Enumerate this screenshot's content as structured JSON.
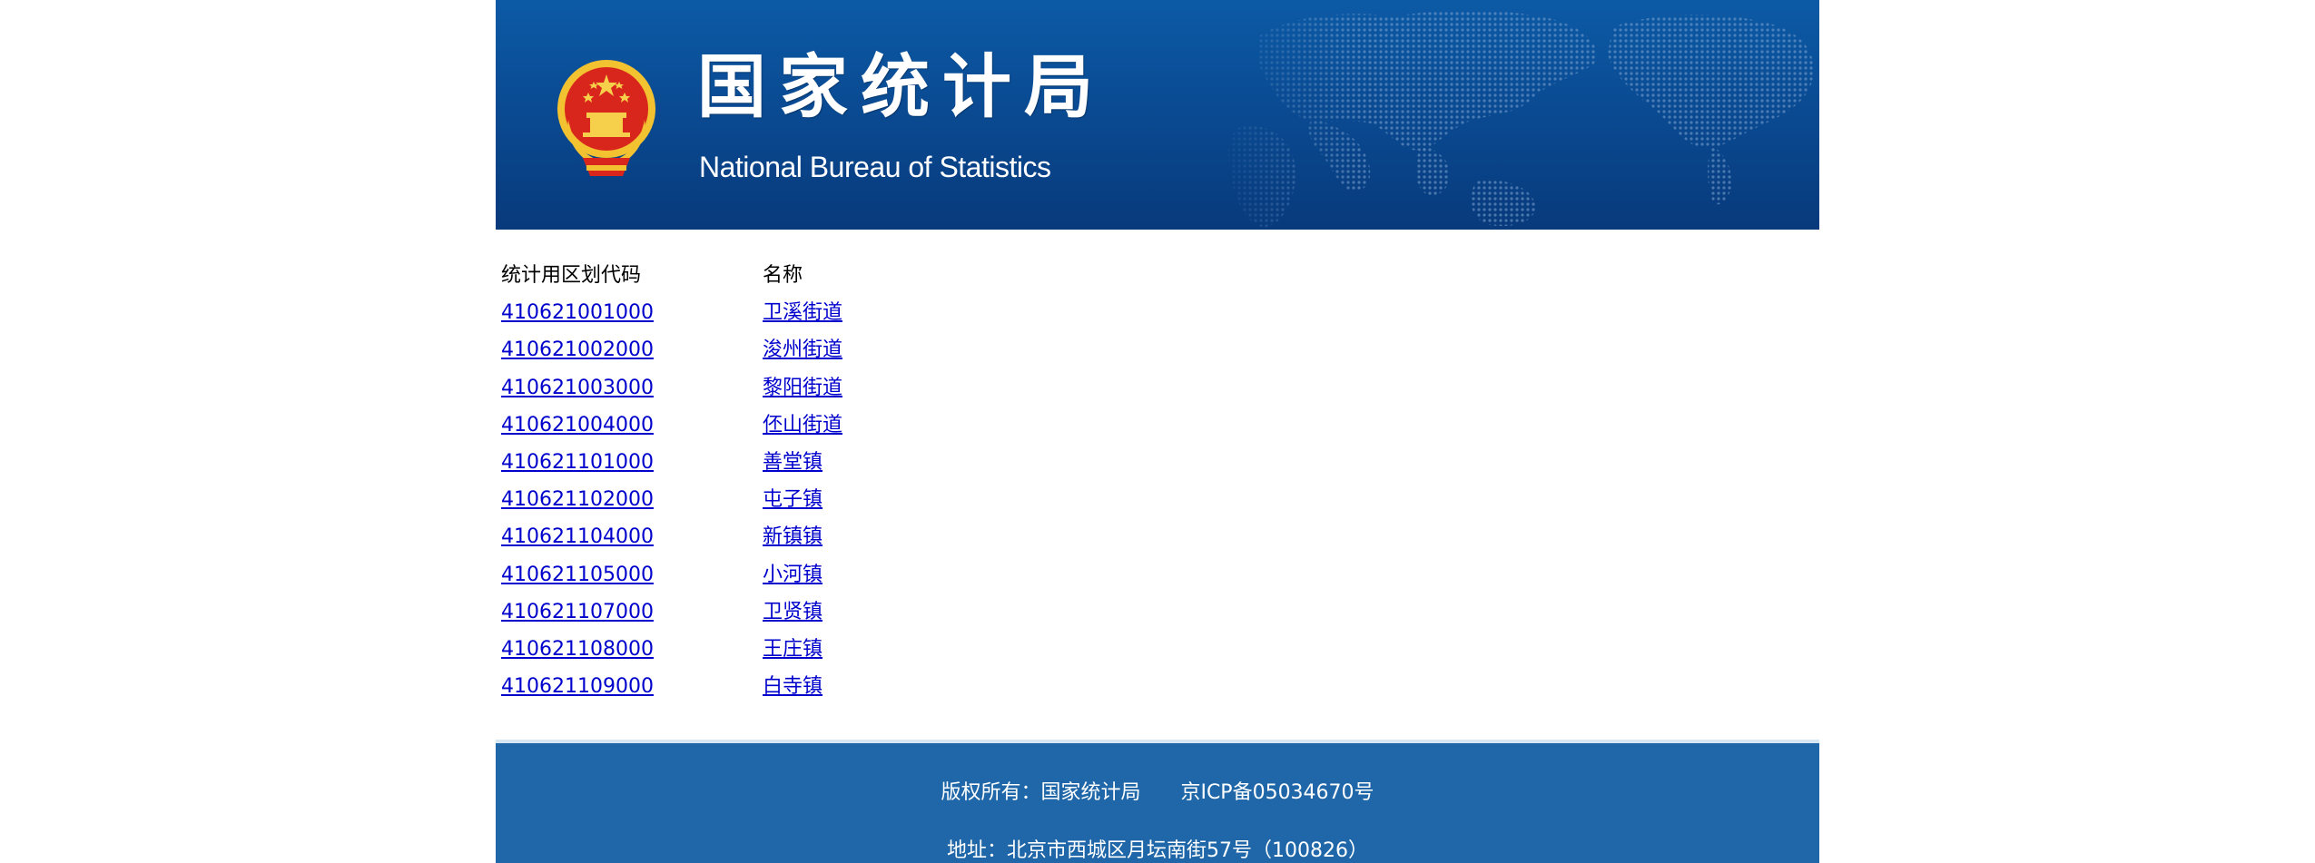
{
  "header": {
    "title_cn": "国家统计局",
    "title_en": "National Bureau of Statistics",
    "emblem_icon": "national-emblem-icon",
    "background_icon": "world-map-icon",
    "colors": {
      "banner_top": "#0c5aa6",
      "banner_bottom": "#083a7c"
    }
  },
  "table": {
    "headers": {
      "code": "统计用区划代码",
      "name": "名称"
    },
    "rows": [
      {
        "code": "410621001000",
        "name": "卫溪街道"
      },
      {
        "code": "410621002000",
        "name": "浚州街道"
      },
      {
        "code": "410621003000",
        "name": "黎阳街道"
      },
      {
        "code": "410621004000",
        "name": "伾山街道"
      },
      {
        "code": "410621101000",
        "name": "善堂镇"
      },
      {
        "code": "410621102000",
        "name": "屯子镇"
      },
      {
        "code": "410621104000",
        "name": "新镇镇"
      },
      {
        "code": "410621105000",
        "name": "小河镇"
      },
      {
        "code": "410621107000",
        "name": "卫贤镇"
      },
      {
        "code": "410621108000",
        "name": "王庄镇"
      },
      {
        "code": "410621109000",
        "name": "白寺镇"
      }
    ],
    "link_color": "#0000cc"
  },
  "footer": {
    "copyright": "版权所有：国家统计局",
    "icp": "京ICP备05034670号",
    "address": "地址：北京市西城区月坛南街57号（100826）",
    "background": "#1f67a8"
  }
}
